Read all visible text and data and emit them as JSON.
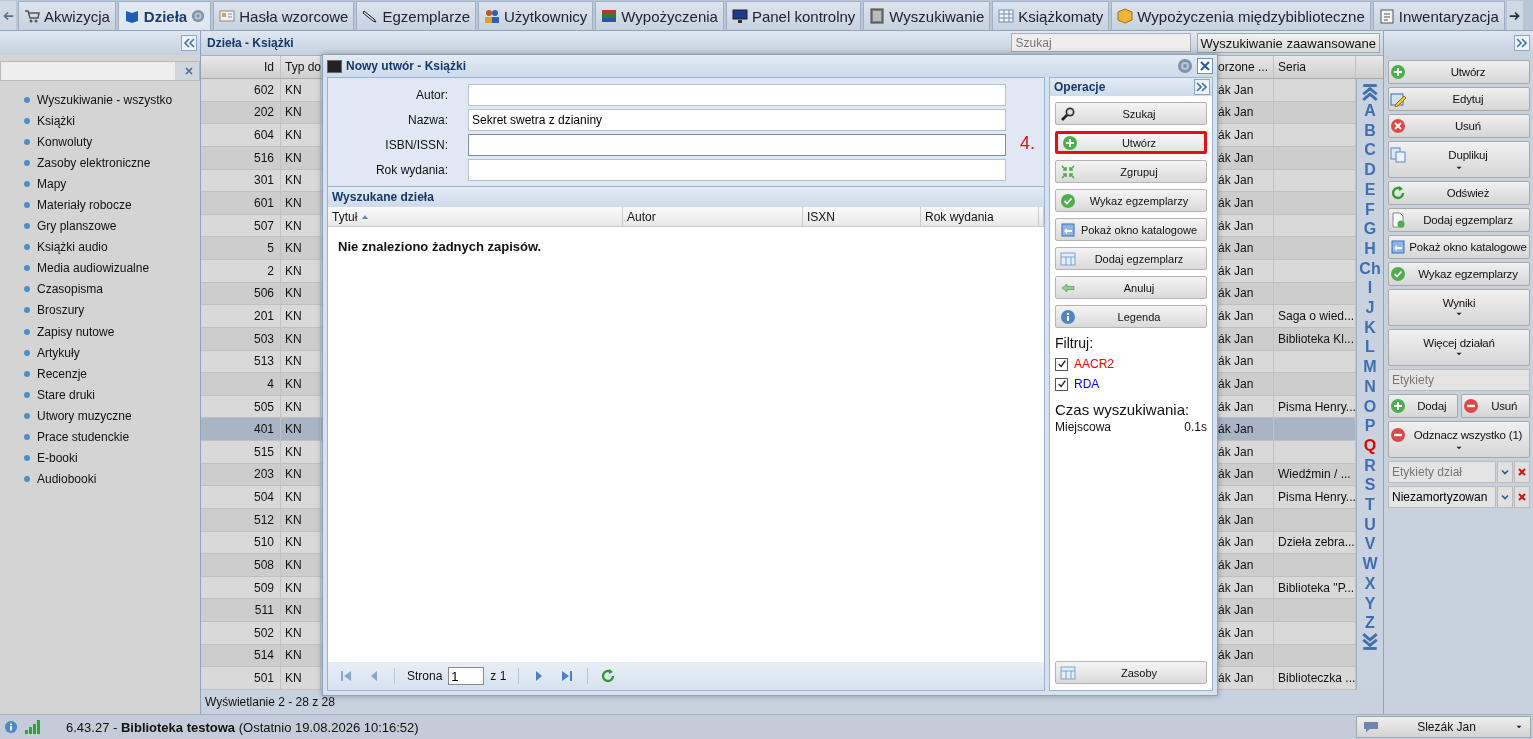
{
  "tabs": [
    {
      "label": "Akwizycja",
      "selected": false
    },
    {
      "label": "Dzieła",
      "selected": true,
      "help": true
    },
    {
      "label": "Hasła wzorcowe",
      "selected": false
    },
    {
      "label": "Egzemplarze",
      "selected": false
    },
    {
      "label": "Użytkownicy",
      "selected": false
    },
    {
      "label": "Wypożyczenia",
      "selected": false
    },
    {
      "label": "Panel kontrolny",
      "selected": false
    },
    {
      "label": "Wyszukiwanie",
      "selected": false
    },
    {
      "label": "Książkomaty",
      "selected": false
    },
    {
      "label": "Wypożyczenia międzybiblioteczne",
      "selected": false
    },
    {
      "label": "Inwentaryzacja",
      "selected": false
    }
  ],
  "sidebar": {
    "items": [
      "Wyszukiwanie - wszystko",
      "Książki",
      "Konwoluty",
      "Zasoby elektroniczne",
      "Mapy",
      "Materiały robocze",
      "Gry planszowe",
      "Książki audio",
      "Media audiowizualne",
      "Czasopisma",
      "Broszury",
      "Zapisy nutowe",
      "Artykuły",
      "Recenzje",
      "Stare druki",
      "Utwory muzyczne",
      "Prace studenckie",
      "E-booki",
      "Audiobooki"
    ]
  },
  "grid": {
    "title": "Dzieła - Książki",
    "search": {
      "placeholder": "Szukaj"
    },
    "advanced_button": "Wyszukiwanie zaawansowane",
    "columns": [
      "Id",
      "Typ do",
      "orzone ...",
      "Seria"
    ],
    "rows": [
      {
        "id": "602",
        "type": "KN",
        "creator": "ák Jan",
        "series": "",
        "selected": false
      },
      {
        "id": "202",
        "type": "KN",
        "creator": "ák Jan",
        "series": "",
        "selected": false
      },
      {
        "id": "604",
        "type": "KN",
        "creator": "ák Jan",
        "series": "",
        "selected": false
      },
      {
        "id": "516",
        "type": "KN",
        "creator": "ák Jan",
        "series": "",
        "selected": false
      },
      {
        "id": "301",
        "type": "KN",
        "creator": "ák Jan",
        "series": "",
        "selected": false
      },
      {
        "id": "601",
        "type": "KN",
        "creator": "ák Jan",
        "series": "",
        "selected": false
      },
      {
        "id": "507",
        "type": "KN",
        "creator": "ák Jan",
        "series": "",
        "selected": false
      },
      {
        "id": "5",
        "type": "KN",
        "creator": "ák Jan",
        "series": "",
        "selected": false
      },
      {
        "id": "2",
        "type": "KN",
        "creator": "ák Jan",
        "series": "",
        "selected": false
      },
      {
        "id": "506",
        "type": "KN",
        "creator": "ák Jan",
        "series": "",
        "selected": false
      },
      {
        "id": "201",
        "type": "KN",
        "creator": "ák Jan",
        "series": "Saga o wied...",
        "selected": false
      },
      {
        "id": "503",
        "type": "KN",
        "creator": "ák Jan",
        "series": "Biblioteka Kl...",
        "selected": false
      },
      {
        "id": "513",
        "type": "KN",
        "creator": "ák Jan",
        "series": "",
        "selected": false
      },
      {
        "id": "4",
        "type": "KN",
        "creator": "ák Jan",
        "series": "",
        "selected": false
      },
      {
        "id": "505",
        "type": "KN",
        "creator": "ák Jan",
        "series": "Pisma Henry...",
        "selected": false
      },
      {
        "id": "401",
        "type": "KN",
        "creator": "ák Jan",
        "series": "",
        "selected": true
      },
      {
        "id": "515",
        "type": "KN",
        "creator": "ák Jan",
        "series": "",
        "selected": false
      },
      {
        "id": "203",
        "type": "KN",
        "creator": "ák Jan",
        "series": "Wiedźmin / ...",
        "selected": false
      },
      {
        "id": "504",
        "type": "KN",
        "creator": "ák Jan",
        "series": "Pisma Henry...",
        "selected": false
      },
      {
        "id": "512",
        "type": "KN",
        "creator": "ák Jan",
        "series": "",
        "selected": false
      },
      {
        "id": "510",
        "type": "KN",
        "creator": "ák Jan",
        "series": "Dzieła zebra...",
        "selected": false
      },
      {
        "id": "508",
        "type": "KN",
        "creator": "ák Jan",
        "series": "",
        "selected": false
      },
      {
        "id": "509",
        "type": "KN",
        "creator": "ák Jan",
        "series": "Biblioteka \"P...",
        "selected": false
      },
      {
        "id": "511",
        "type": "KN",
        "creator": "ák Jan",
        "series": "",
        "selected": false
      },
      {
        "id": "502",
        "type": "KN",
        "creator": "ák Jan",
        "series": "",
        "selected": false
      },
      {
        "id": "514",
        "type": "KN",
        "creator": "ák Jan",
        "series": "",
        "selected": false
      },
      {
        "id": "501",
        "type": "KN",
        "creator": "ák Jan",
        "series": "Biblioteczka ...",
        "selected": false
      }
    ],
    "footer": "Wyświetlanie 2 - 28 z 28"
  },
  "alphabet": [
    {
      "label": "A",
      "selected": false
    },
    {
      "label": "B",
      "selected": false
    },
    {
      "label": "C",
      "selected": false
    },
    {
      "label": "D",
      "selected": false
    },
    {
      "label": "E",
      "selected": false
    },
    {
      "label": "F",
      "selected": false
    },
    {
      "label": "G",
      "selected": false
    },
    {
      "label": "H",
      "selected": false
    },
    {
      "label": "Ch",
      "selected": false
    },
    {
      "label": "I",
      "selected": false
    },
    {
      "label": "J",
      "selected": false
    },
    {
      "label": "K",
      "selected": false
    },
    {
      "label": "L",
      "selected": false
    },
    {
      "label": "M",
      "selected": false
    },
    {
      "label": "N",
      "selected": false
    },
    {
      "label": "O",
      "selected": false
    },
    {
      "label": "P",
      "selected": false
    },
    {
      "label": "Q",
      "selected": true
    },
    {
      "label": "R",
      "selected": false
    },
    {
      "label": "S",
      "selected": false
    },
    {
      "label": "T",
      "selected": false
    },
    {
      "label": "U",
      "selected": false
    },
    {
      "label": "V",
      "selected": false
    },
    {
      "label": "W",
      "selected": false
    },
    {
      "label": "X",
      "selected": false
    },
    {
      "label": "Y",
      "selected": false
    },
    {
      "label": "Z",
      "selected": false
    }
  ],
  "actions": [
    {
      "label": "Utwórz",
      "menu": false
    },
    {
      "label": "Edytuj",
      "menu": false
    },
    {
      "label": "Usuń",
      "menu": false
    },
    {
      "label": "Duplikuj",
      "menu": true
    },
    {
      "label": "Odśwież",
      "menu": false
    },
    {
      "label": "Dodaj egzemplarz",
      "menu": false
    },
    {
      "label": "Pokaż okno katalogowe",
      "menu": false
    },
    {
      "label": "Wykaz egzemplarzy",
      "menu": false
    },
    {
      "label": "Wyniki",
      "menu": true
    },
    {
      "label": "Więcej działań",
      "menu": true
    }
  ],
  "labels": {
    "placeholder": "Etykiety",
    "add": "Dodaj",
    "remove": "Usuń",
    "unselect": "Odznacz wszystko (1)",
    "work_labels": {
      "placeholder": "Etykiety dział"
    },
    "filter": {
      "value": "Niezamortyzowan"
    }
  },
  "dialog": {
    "title": "Nowy utwór - Książki",
    "fields": [
      {
        "label": "Autor:",
        "focused": false
      },
      {
        "label": "Nazwa:",
        "value": "Sekret swetra z dzianiny",
        "focused": false
      },
      {
        "label": "ISBN/ISSN:",
        "focused": true
      },
      {
        "label": "Rok wydania:",
        "focused": false
      }
    ],
    "results": {
      "title": "Wyszukane dzieła",
      "columns": [
        "Tytuł",
        "Autor",
        "ISXN",
        "Rok wydania"
      ],
      "empty": "Nie znaleziono żadnych zapisów."
    },
    "pager": {
      "page_label": "Strona",
      "page": "1",
      "of": "z 1"
    },
    "operations": {
      "title": "Operacje",
      "step": "4.",
      "buttons": [
        {
          "label": "Szukaj",
          "highlighted": false
        },
        {
          "label": "Utwórz",
          "highlighted": true
        },
        {
          "label": "Zgrupuj",
          "highlighted": false
        },
        {
          "label": "Wykaz egzemplarzy",
          "highlighted": false
        },
        {
          "label": "Pokaż okno katalogowe",
          "highlighted": false
        },
        {
          "label": "Dodaj egzemplarz",
          "highlighted": false
        },
        {
          "label": "Anuluj",
          "highlighted": false
        },
        {
          "label": "Legenda",
          "highlighted": false
        }
      ],
      "filter_title": "Filtruj:",
      "filters": [
        {
          "label": "AACR2",
          "checked": true,
          "color": "#ff0000"
        },
        {
          "label": "RDA",
          "checked": true,
          "color": "#0000ff"
        }
      ],
      "time_title": "Czas wyszukiwania:",
      "time_label": "Miejscowa",
      "time_value": "0.1s",
      "bottom_button": "Zasoby"
    }
  },
  "status_bar": {
    "text": "6.43.27 - **Biblioteka testowa** (Ostatnio 19.08.2026 10:16:52)",
    "user": "Slezák Jan"
  }
}
